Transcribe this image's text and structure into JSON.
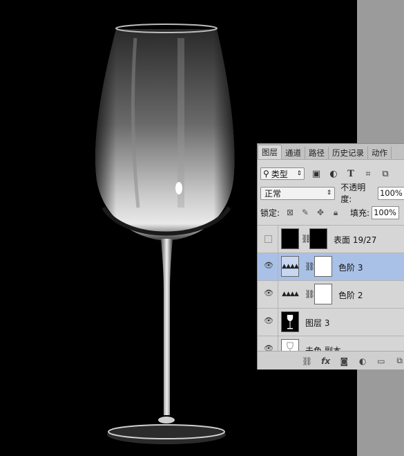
{
  "panel": {
    "tabs": [
      "图层",
      "通道",
      "路径",
      "历史记录",
      "动作"
    ],
    "filter": {
      "label": "类型",
      "icon": "search-icon"
    },
    "filter_icons": [
      "image-filter-icon",
      "adjustment-filter-icon",
      "type-filter-icon",
      "shape-filter-icon",
      "smart-object-filter-icon"
    ],
    "blend_mode": "正常",
    "opacity_label": "不透明度:",
    "opacity_value": "100%",
    "lock_label": "锁定:",
    "fill_label": "填充:",
    "fill_value": "100%",
    "layers": [
      {
        "name": "表面 19/27",
        "visible": false,
        "selected": false,
        "thumb": "black",
        "mask": "black"
      },
      {
        "name": "色阶 3",
        "visible": true,
        "selected": true,
        "thumb": "levels",
        "mask": "white"
      },
      {
        "name": "色阶 2",
        "visible": true,
        "selected": false,
        "thumb": "levels",
        "mask": "white"
      },
      {
        "name": "图层 3",
        "visible": true,
        "selected": false,
        "thumb": "glass",
        "mask": null
      },
      {
        "name": "去色 副本",
        "visible": true,
        "selected": false,
        "thumb": "glass-white",
        "mask": null
      }
    ],
    "footer_icons": [
      "link-icon",
      "fx-icon",
      "mask-icon",
      "adjustment-icon",
      "folder-icon",
      "new-layer-icon"
    ]
  },
  "colors": {
    "selected_row": "#a9c1e6",
    "canvas": "#000000",
    "panel": "#d6d6d6"
  }
}
